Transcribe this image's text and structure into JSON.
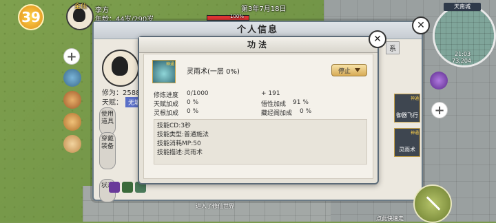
{
  "hud": {
    "level": "39",
    "player_name": "李方",
    "age_label": "年龄：44岁/290岁",
    "cultivation_tag": "金仙",
    "world_date": "第3年7月18日",
    "enemy_hp": "100%",
    "chat_prefix": "进入了修仙世界",
    "corner_text": "点此快速走"
  },
  "minimap": {
    "city": "天南城",
    "time": "21:03",
    "coords": "73,204"
  },
  "profile_window": {
    "title": "个人信息",
    "cultivation_label": "修为：2588",
    "talent_label": "天赋：",
    "talent_value": "无垢",
    "tabs": [
      "使用道具",
      "穿戴装备",
      "状态"
    ],
    "skill_slots": [
      {
        "tag": "神通",
        "label": "御器飞行"
      },
      {
        "tag": "神通",
        "label": "灵雨术"
      }
    ],
    "extra_tab": "系"
  },
  "skill_window": {
    "title": "功法",
    "skill_icon_tag": "神通",
    "skill_name": "灵雨术(一层 0%)",
    "action_label": "停止",
    "stats": {
      "progress_label": "修炼进度",
      "progress_value": "0/1000",
      "gain": "+ 191",
      "talent_bonus_label": "天赋加成",
      "talent_bonus_value": "0 %",
      "comprehension_label": "悟性加成",
      "comprehension_value": "91 %",
      "root_bonus_label": "灵根加成",
      "root_bonus_value": "0 %",
      "library_label": "藏经阁加成",
      "library_value": "0 %"
    },
    "info": [
      "技能CD:3秒",
      "技能类型:普通施法",
      "技能消耗MP:50",
      "技能描述:灵雨术"
    ]
  },
  "colors": {
    "window_border": "#5c6b78",
    "stop_button": "#d7ab55",
    "talent_badge": "#5a6fc7"
  }
}
